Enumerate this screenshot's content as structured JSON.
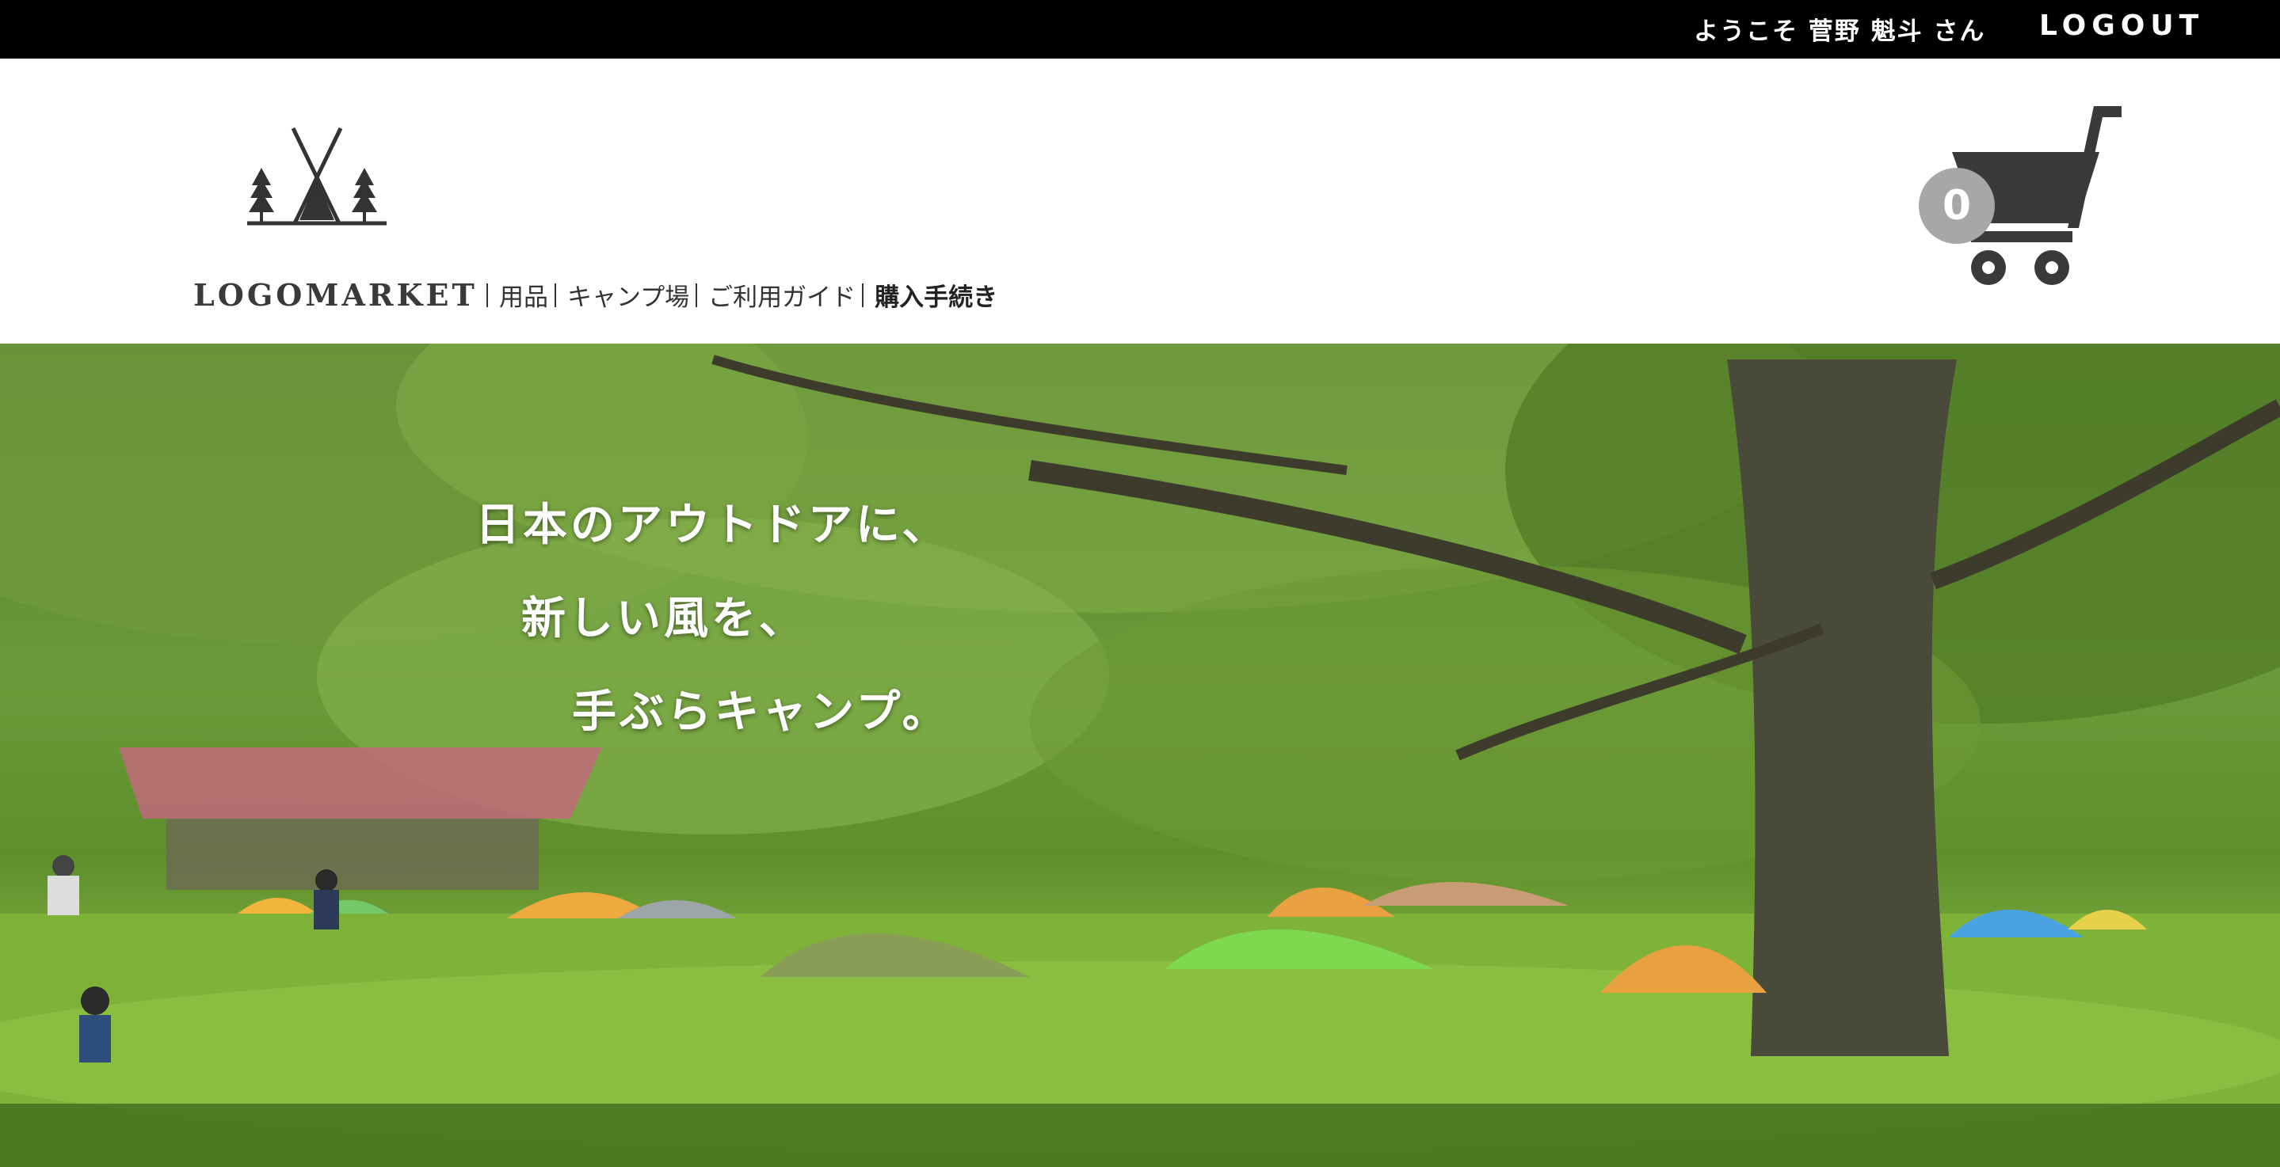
{
  "topbar": {
    "welcome": "ようこそ 菅野 魁斗 さん",
    "logout": "LOGOUT"
  },
  "header": {
    "brand": "LOGOMARKET",
    "logo_icon": "tent-trees-icon",
    "nav": [
      {
        "label": "用品"
      },
      {
        "label": "キャンプ場"
      },
      {
        "label": "ご利用ガイド"
      },
      {
        "label": "購入手続き"
      }
    ],
    "cart": {
      "icon": "shopping-cart-icon",
      "count": "0"
    }
  },
  "hero": {
    "lines": [
      "日本のアウトドアに、",
      "新しい風を、",
      "手ぶらキャンプ。"
    ]
  },
  "colors": {
    "topbar": "#000000",
    "cart_icon": "#3a3a3a",
    "cart_badge": "#a7a7a7",
    "hero_green": "#5f8f2c"
  }
}
